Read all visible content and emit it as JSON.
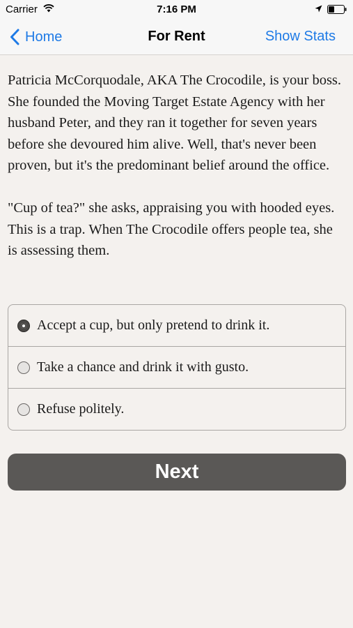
{
  "status_bar": {
    "carrier": "Carrier",
    "time": "7:16 PM",
    "icons": [
      "wifi-icon",
      "location-icon",
      "battery-icon"
    ]
  },
  "nav": {
    "back_label": "Home",
    "title": "For Rent",
    "right_label": "Show Stats",
    "accent_color": "#1e7ae6"
  },
  "story": {
    "paragraphs": [
      "Patricia McCorquodale, AKA The Crocodile, is your boss. She founded the Moving Target Estate Agency with her husband Peter, and they ran it together for seven years before she devoured him alive. Well, that's never been proven, but it's the predominant belief around the office.",
      "\"Cup of tea?\" she asks, appraising you with hooded eyes. This is a trap. When The Crocodile offers people tea, she is assessing them."
    ]
  },
  "choices": {
    "selected_index": 0,
    "options": [
      "Accept a cup, but only pretend to drink it.",
      "Take a chance and drink it with gusto.",
      "Refuse politely."
    ]
  },
  "next_label": "Next"
}
